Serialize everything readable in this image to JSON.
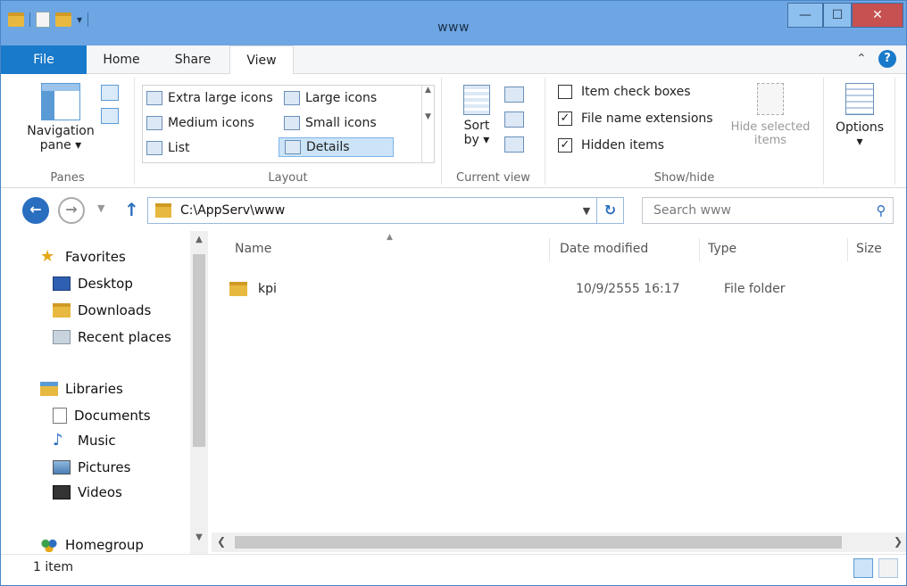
{
  "window": {
    "title": "www"
  },
  "tabs": {
    "file": "File",
    "home": "Home",
    "share": "Share",
    "view": "View"
  },
  "ribbon": {
    "panes": {
      "label": "Panes",
      "navigation_pane": "Navigation",
      "navigation_pane_line2": "pane ▾"
    },
    "layout": {
      "label": "Layout",
      "extra_large_icons": "Extra large icons",
      "large_icons": "Large icons",
      "medium_icons": "Medium icons",
      "small_icons": "Small icons",
      "list": "List",
      "details": "Details"
    },
    "current_view": {
      "label": "Current view",
      "sort_by": "Sort",
      "sort_by_line2": "by ▾"
    },
    "show_hide": {
      "label": "Show/hide",
      "item_check_boxes": "Item check boxes",
      "file_name_extensions": "File name extensions",
      "hidden_items": "Hidden items",
      "item_check_boxes_checked": false,
      "file_name_extensions_checked": true,
      "hidden_items_checked": true,
      "hide_selected": "Hide selected",
      "hide_selected_line2": "items"
    },
    "options": {
      "label": "Options",
      "caret": "▾"
    }
  },
  "address": {
    "path": "C:\\AppServ\\www"
  },
  "search": {
    "placeholder": "Search www"
  },
  "nav": {
    "favorites": "Favorites",
    "desktop": "Desktop",
    "downloads": "Downloads",
    "recent_places": "Recent places",
    "libraries": "Libraries",
    "documents": "Documents",
    "music": "Music",
    "pictures": "Pictures",
    "videos": "Videos",
    "homegroup": "Homegroup"
  },
  "columns": {
    "name": "Name",
    "date_modified": "Date modified",
    "type": "Type",
    "size": "Size"
  },
  "files": [
    {
      "name": "kpi",
      "date_modified": "10/9/2555 16:17",
      "type": "File folder",
      "size": ""
    }
  ],
  "status": {
    "item_count": "1 item"
  },
  "colors": {
    "accent": "#1979ca",
    "titlebar": "#6da6e3",
    "close": "#c75050",
    "folder": "#e8b940"
  }
}
